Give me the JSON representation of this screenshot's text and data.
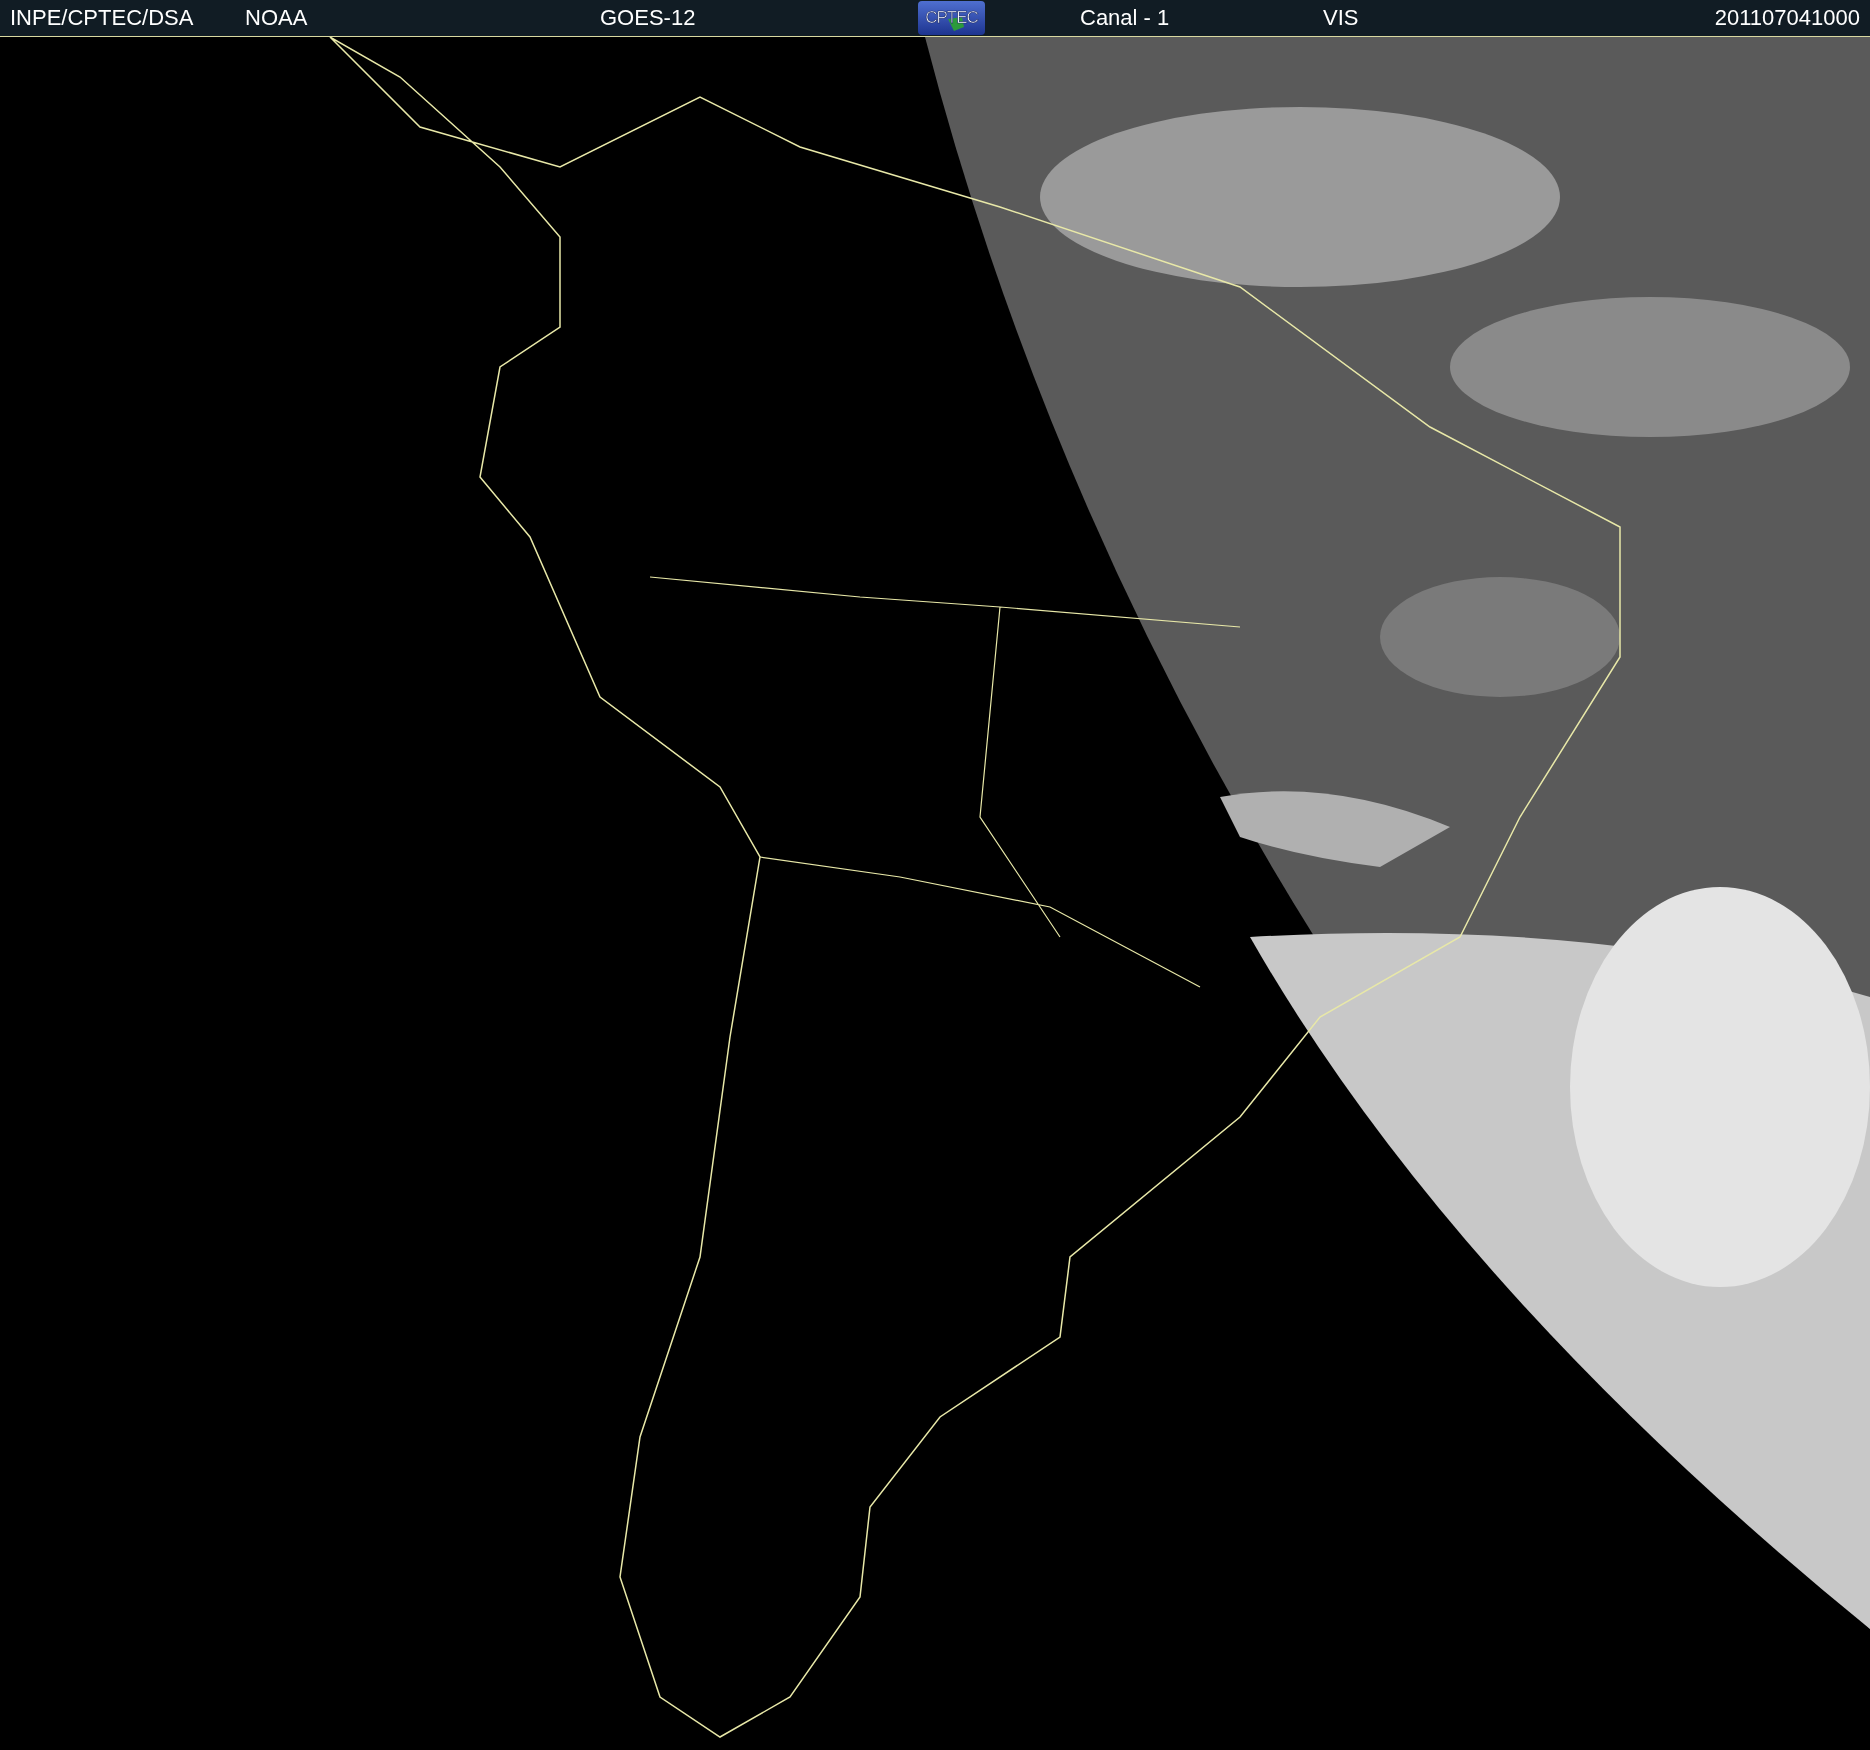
{
  "header": {
    "items": [
      {
        "kind": "text",
        "text": "INPE/CPTEC/DSA"
      },
      {
        "kind": "text",
        "text": "NOAA"
      },
      {
        "kind": "text",
        "text": "GOES-12"
      },
      {
        "kind": "logo",
        "text": "CPTEC"
      },
      {
        "kind": "text",
        "text": "Canal - 1"
      },
      {
        "kind": "text",
        "text": "VIS"
      },
      {
        "kind": "text",
        "text": "201107041000"
      }
    ]
  }
}
